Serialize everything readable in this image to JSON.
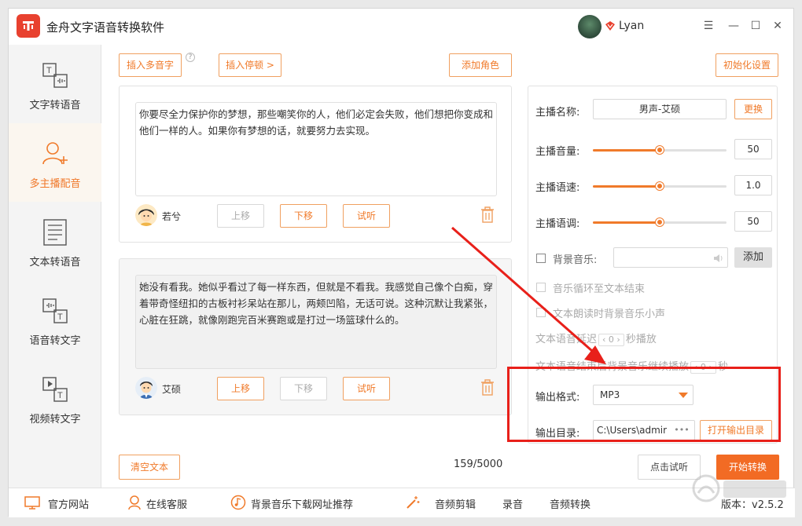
{
  "app": {
    "title": "金舟文字语音转换软件",
    "username": "Lyan"
  },
  "sidebar": {
    "items": [
      {
        "label": "文字转语音",
        "icon": "text-to-speech-icon"
      },
      {
        "label": "多主播配音",
        "icon": "multi-host-icon",
        "active": true
      },
      {
        "label": "文本转语音",
        "icon": "document-to-speech-icon"
      },
      {
        "label": "语音转文字",
        "icon": "speech-to-text-icon"
      },
      {
        "label": "视频转文字",
        "icon": "video-to-text-icon"
      }
    ]
  },
  "toolbar": {
    "insert_polyphone": "插入多音字",
    "insert_pause": "插入停顿 >",
    "add_role": "添加角色",
    "reset_settings": "初始化设置",
    "help": "?"
  },
  "segments": [
    {
      "text": "你要尽全力保护你的梦想，那些嘲笑你的人，他们必定会失败，他们想把你变成和他们一样的人。如果你有梦想的话，就要努力去实现。",
      "speaker": "若兮",
      "move_up": "上移",
      "move_down": "下移",
      "preview": "试听"
    },
    {
      "text": "她没有看我。她似乎看过了每一样东西，但就是不看我。我感觉自己像个白痴，穿着带奇怪纽扣的古板衬衫呆站在那儿，两颊凹陷，无话可说。这种沉默让我紧张，心脏在狂跳，就像刚跑完百米赛跑或是打过一场篮球什么的。",
      "speaker": "艾硕",
      "move_up": "上移",
      "move_down": "下移",
      "preview": "试听"
    }
  ],
  "settings": {
    "host_name_label": "主播名称:",
    "host_name_value": "男声-艾硕",
    "change_button": "更换",
    "volume_label": "主播音量:",
    "volume_value": "50",
    "volume_level": 0.5,
    "speed_label": "主播语速:",
    "speed_value": "1.0",
    "speed_level": 0.5,
    "pitch_label": "主播语调:",
    "pitch_value": "50",
    "pitch_level": 0.5,
    "bg_music_label": "背景音乐:",
    "bg_music_add": "添加",
    "loop_label": "音乐循环至文本结束",
    "lower_label": "文本朗读时背景音乐小声",
    "delay_prefix": "文本语音延迟",
    "delay_value": "0",
    "delay_suffix": "秒播放",
    "continue_prefix": "文本语音结束后背景音乐继续播放",
    "continue_value": "0",
    "continue_suffix": "秒",
    "format_label": "输出格式:",
    "format_value": "MP3",
    "dir_label": "输出目录:",
    "dir_value": "C:\\Users\\admir",
    "dir_more": "•••",
    "open_dir": "打开输出目录"
  },
  "bottom": {
    "clear_text": "清空文本",
    "char_count": "159/5000",
    "preview_click": "点击试听",
    "start_convert": "开始转换"
  },
  "footer": {
    "website": "官方网站",
    "support": "在线客服",
    "bg_music_links": "背景音乐下载网址推荐",
    "audio_cut": "音频剪辑",
    "record": "录音",
    "audio_convert": "音频转换",
    "version": "版本：v2.5.2"
  },
  "colors": {
    "accent": "#f07a2a",
    "primary_button": "#f26b24",
    "annotation": "#e8201a"
  }
}
